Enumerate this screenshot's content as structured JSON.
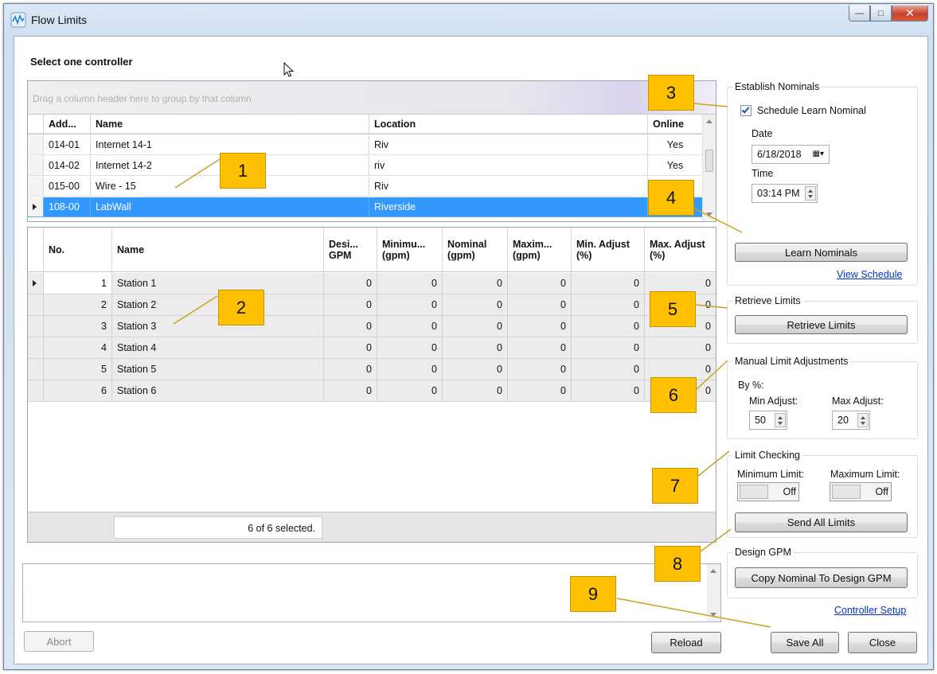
{
  "window": {
    "title": "Flow Limits"
  },
  "heading": "Select one controller",
  "controllers": {
    "group_hint": "Drag a column header here to group by that column",
    "columns": [
      "Add...",
      "Name",
      "Location",
      "Online"
    ],
    "rows": [
      {
        "address": "014-01",
        "name": "Internet 14-1",
        "location": "Riv",
        "online": "Yes"
      },
      {
        "address": "014-02",
        "name": "Internet 14-2",
        "location": "riv",
        "online": "Yes"
      },
      {
        "address": "015-00",
        "name": "Wire - 15",
        "location": "Riv",
        "online": ""
      },
      {
        "address": "108-00",
        "name": "LabWall",
        "location": "Riverside",
        "online": ""
      }
    ]
  },
  "stations": {
    "columns": [
      "No.",
      "Name",
      "Desi... GPM",
      "Minimu... (gpm)",
      "Nominal (gpm)",
      "Maxim... (gpm)",
      "Min. Adjust (%)",
      "Max. Adjust (%)"
    ],
    "rows": [
      {
        "no": "1",
        "name": "Station 1",
        "design": "0",
        "min": "0",
        "nominal": "0",
        "max": "0",
        "min_adj": "0",
        "max_adj": "0"
      },
      {
        "no": "2",
        "name": "Station 2",
        "design": "0",
        "min": "0",
        "nominal": "0",
        "max": "0",
        "min_adj": "0",
        "max_adj": "0"
      },
      {
        "no": "3",
        "name": "Station 3",
        "design": "0",
        "min": "0",
        "nominal": "0",
        "max": "0",
        "min_adj": "0",
        "max_adj": "0"
      },
      {
        "no": "4",
        "name": "Station 4",
        "design": "0",
        "min": "0",
        "nominal": "0",
        "max": "0",
        "min_adj": "0",
        "max_adj": "0"
      },
      {
        "no": "5",
        "name": "Station 5",
        "design": "0",
        "min": "0",
        "nominal": "0",
        "max": "0",
        "min_adj": "0",
        "max_adj": "0"
      },
      {
        "no": "6",
        "name": "Station 6",
        "design": "0",
        "min": "0",
        "nominal": "0",
        "max": "0",
        "min_adj": "0",
        "max_adj": "0"
      }
    ],
    "selection_text": "6 of 6 selected."
  },
  "buttons": {
    "abort": "Abort",
    "reload": "Reload",
    "save_all": "Save All",
    "close": "Close"
  },
  "establish_nominals": {
    "title": "Establish Nominals",
    "checkbox_label": "Schedule Learn Nominal",
    "date_label": "Date",
    "date_value": "6/18/2018",
    "time_label": "Time",
    "time_value": "03:14 PM",
    "learn_button": "Learn Nominals",
    "view_schedule_link": "View Schedule"
  },
  "retrieve_limits": {
    "title": "Retrieve Limits",
    "button": "Retrieve Limits"
  },
  "manual_adjust": {
    "title": "Manual Limit Adjustments",
    "by_label": "By %:",
    "min_label": "Min Adjust:",
    "min_value": "50",
    "max_label": "Max Adjust:",
    "max_value": "20"
  },
  "limit_checking": {
    "title": "Limit Checking",
    "min_label": "Minimum Limit:",
    "max_label": "Maximum Limit:",
    "min_state": "Off",
    "max_state": "Off",
    "send_button": "Send All Limits"
  },
  "design_gpm": {
    "title": "Design GPM",
    "button": "Copy Nominal To Design GPM"
  },
  "controller_setup_link": "Controller Setup",
  "callouts": [
    "1",
    "2",
    "3",
    "4",
    "5",
    "6",
    "7",
    "8",
    "9"
  ],
  "colors": {
    "selection": "#3399ff",
    "callout": "#ffc000",
    "link": "#0033cc"
  }
}
